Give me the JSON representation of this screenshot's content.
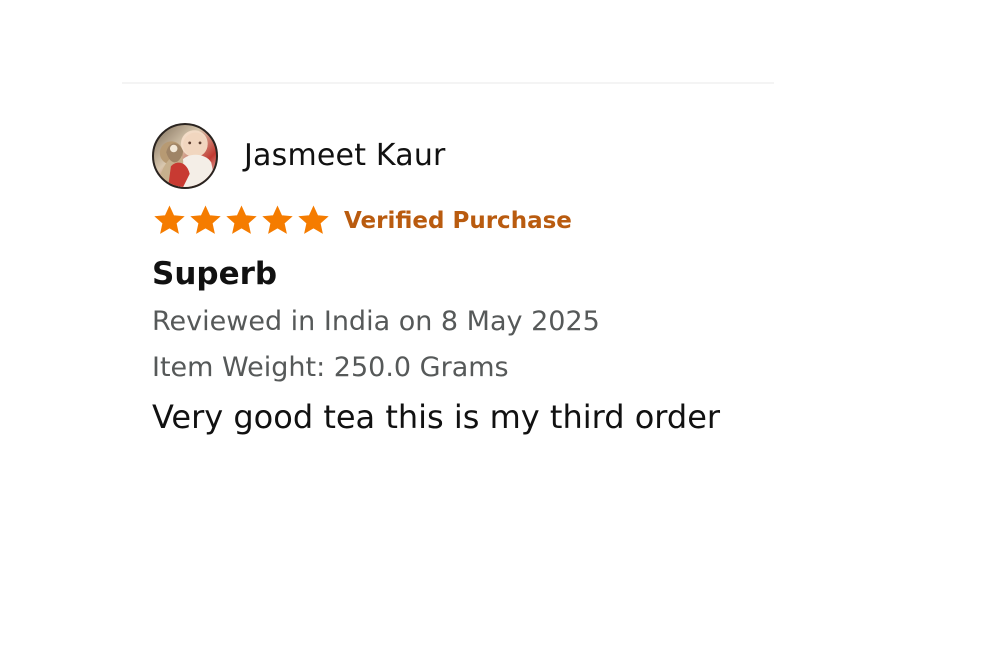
{
  "reviewer": {
    "name": "Jasmeet Kaur",
    "avatar_icon": "profile-photo"
  },
  "rating": {
    "stars_filled": 5,
    "stars_total": 5,
    "star_color": "#f57c00",
    "verified_label": "Verified Purchase",
    "verified_color": "#b95b0f"
  },
  "review": {
    "title": "Superb",
    "date": "Reviewed in India on 8 May 2025",
    "variant": "Item Weight: 250.0 Grams",
    "body": "Very good tea this is my third order"
  }
}
